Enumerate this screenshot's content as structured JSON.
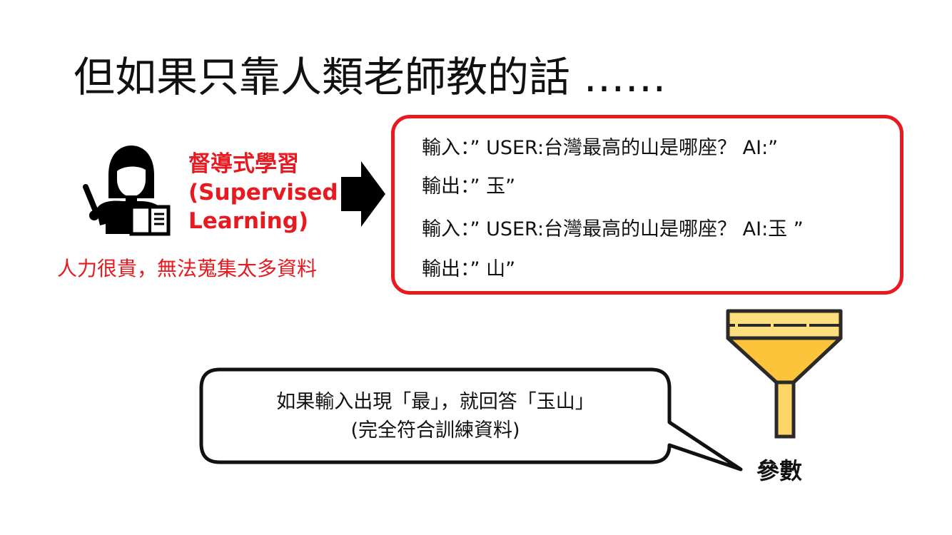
{
  "slide": {
    "title": "但如果只靠人類老師教的話 ……"
  },
  "supervised": {
    "line1": "督導式學習",
    "line2": "(Supervised",
    "line3": "Learning)",
    "cost_note": "人力很貴，無法蒐集太多資料"
  },
  "examples": [
    {
      "text": "輸入：”  USER:台灣最高的山是哪座？ AI:”"
    },
    {
      "text": "輸出：”  玉”"
    },
    {
      "text": "輸入：”  USER:台灣最高的山是哪座？ AI:玉 ”"
    },
    {
      "text": "輸出：”  山”"
    }
  ],
  "bubble": {
    "line1": "如果輸入出現「最」，就回答「玉山」",
    "line2": "(完全符合訓練資料)"
  },
  "params": {
    "label": "參數"
  },
  "colors": {
    "accent_red": "#e8191f",
    "funnel_fill": "#fdd565",
    "funnel_stroke": "#2a2a2a",
    "text": "#111111"
  },
  "icons": {
    "teacher": "teacher-with-pointer-and-book-icon",
    "arrow": "right-arrow-icon",
    "funnel": "funnel-icon"
  }
}
